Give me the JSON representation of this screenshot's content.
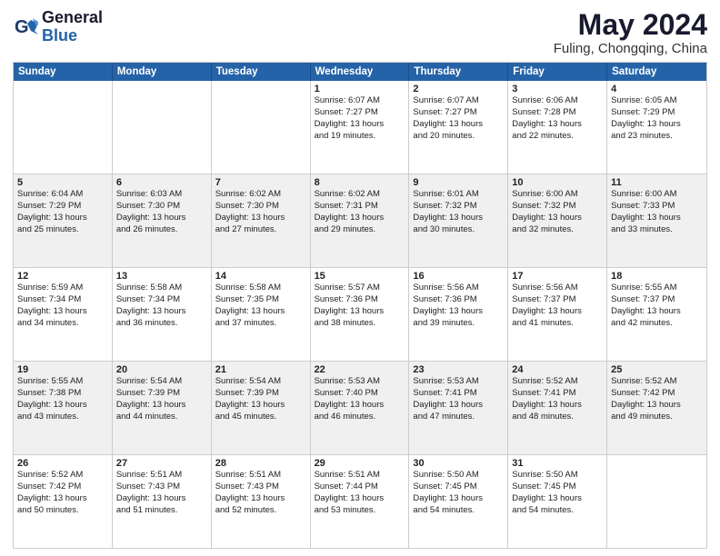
{
  "logo": {
    "line1": "General",
    "line2": "Blue"
  },
  "title": "May 2024",
  "subtitle": "Fuling, Chongqing, China",
  "days": [
    "Sunday",
    "Monday",
    "Tuesday",
    "Wednesday",
    "Thursday",
    "Friday",
    "Saturday"
  ],
  "rows": [
    {
      "alt": false,
      "cells": [
        {
          "day": "",
          "lines": []
        },
        {
          "day": "",
          "lines": []
        },
        {
          "day": "",
          "lines": []
        },
        {
          "day": "1",
          "lines": [
            "Sunrise: 6:07 AM",
            "Sunset: 7:27 PM",
            "Daylight: 13 hours",
            "and 19 minutes."
          ]
        },
        {
          "day": "2",
          "lines": [
            "Sunrise: 6:07 AM",
            "Sunset: 7:27 PM",
            "Daylight: 13 hours",
            "and 20 minutes."
          ]
        },
        {
          "day": "3",
          "lines": [
            "Sunrise: 6:06 AM",
            "Sunset: 7:28 PM",
            "Daylight: 13 hours",
            "and 22 minutes."
          ]
        },
        {
          "day": "4",
          "lines": [
            "Sunrise: 6:05 AM",
            "Sunset: 7:29 PM",
            "Daylight: 13 hours",
            "and 23 minutes."
          ]
        }
      ]
    },
    {
      "alt": true,
      "cells": [
        {
          "day": "5",
          "lines": [
            "Sunrise: 6:04 AM",
            "Sunset: 7:29 PM",
            "Daylight: 13 hours",
            "and 25 minutes."
          ]
        },
        {
          "day": "6",
          "lines": [
            "Sunrise: 6:03 AM",
            "Sunset: 7:30 PM",
            "Daylight: 13 hours",
            "and 26 minutes."
          ]
        },
        {
          "day": "7",
          "lines": [
            "Sunrise: 6:02 AM",
            "Sunset: 7:30 PM",
            "Daylight: 13 hours",
            "and 27 minutes."
          ]
        },
        {
          "day": "8",
          "lines": [
            "Sunrise: 6:02 AM",
            "Sunset: 7:31 PM",
            "Daylight: 13 hours",
            "and 29 minutes."
          ]
        },
        {
          "day": "9",
          "lines": [
            "Sunrise: 6:01 AM",
            "Sunset: 7:32 PM",
            "Daylight: 13 hours",
            "and 30 minutes."
          ]
        },
        {
          "day": "10",
          "lines": [
            "Sunrise: 6:00 AM",
            "Sunset: 7:32 PM",
            "Daylight: 13 hours",
            "and 32 minutes."
          ]
        },
        {
          "day": "11",
          "lines": [
            "Sunrise: 6:00 AM",
            "Sunset: 7:33 PM",
            "Daylight: 13 hours",
            "and 33 minutes."
          ]
        }
      ]
    },
    {
      "alt": false,
      "cells": [
        {
          "day": "12",
          "lines": [
            "Sunrise: 5:59 AM",
            "Sunset: 7:34 PM",
            "Daylight: 13 hours",
            "and 34 minutes."
          ]
        },
        {
          "day": "13",
          "lines": [
            "Sunrise: 5:58 AM",
            "Sunset: 7:34 PM",
            "Daylight: 13 hours",
            "and 36 minutes."
          ]
        },
        {
          "day": "14",
          "lines": [
            "Sunrise: 5:58 AM",
            "Sunset: 7:35 PM",
            "Daylight: 13 hours",
            "and 37 minutes."
          ]
        },
        {
          "day": "15",
          "lines": [
            "Sunrise: 5:57 AM",
            "Sunset: 7:36 PM",
            "Daylight: 13 hours",
            "and 38 minutes."
          ]
        },
        {
          "day": "16",
          "lines": [
            "Sunrise: 5:56 AM",
            "Sunset: 7:36 PM",
            "Daylight: 13 hours",
            "and 39 minutes."
          ]
        },
        {
          "day": "17",
          "lines": [
            "Sunrise: 5:56 AM",
            "Sunset: 7:37 PM",
            "Daylight: 13 hours",
            "and 41 minutes."
          ]
        },
        {
          "day": "18",
          "lines": [
            "Sunrise: 5:55 AM",
            "Sunset: 7:37 PM",
            "Daylight: 13 hours",
            "and 42 minutes."
          ]
        }
      ]
    },
    {
      "alt": true,
      "cells": [
        {
          "day": "19",
          "lines": [
            "Sunrise: 5:55 AM",
            "Sunset: 7:38 PM",
            "Daylight: 13 hours",
            "and 43 minutes."
          ]
        },
        {
          "day": "20",
          "lines": [
            "Sunrise: 5:54 AM",
            "Sunset: 7:39 PM",
            "Daylight: 13 hours",
            "and 44 minutes."
          ]
        },
        {
          "day": "21",
          "lines": [
            "Sunrise: 5:54 AM",
            "Sunset: 7:39 PM",
            "Daylight: 13 hours",
            "and 45 minutes."
          ]
        },
        {
          "day": "22",
          "lines": [
            "Sunrise: 5:53 AM",
            "Sunset: 7:40 PM",
            "Daylight: 13 hours",
            "and 46 minutes."
          ]
        },
        {
          "day": "23",
          "lines": [
            "Sunrise: 5:53 AM",
            "Sunset: 7:41 PM",
            "Daylight: 13 hours",
            "and 47 minutes."
          ]
        },
        {
          "day": "24",
          "lines": [
            "Sunrise: 5:52 AM",
            "Sunset: 7:41 PM",
            "Daylight: 13 hours",
            "and 48 minutes."
          ]
        },
        {
          "day": "25",
          "lines": [
            "Sunrise: 5:52 AM",
            "Sunset: 7:42 PM",
            "Daylight: 13 hours",
            "and 49 minutes."
          ]
        }
      ]
    },
    {
      "alt": false,
      "cells": [
        {
          "day": "26",
          "lines": [
            "Sunrise: 5:52 AM",
            "Sunset: 7:42 PM",
            "Daylight: 13 hours",
            "and 50 minutes."
          ]
        },
        {
          "day": "27",
          "lines": [
            "Sunrise: 5:51 AM",
            "Sunset: 7:43 PM",
            "Daylight: 13 hours",
            "and 51 minutes."
          ]
        },
        {
          "day": "28",
          "lines": [
            "Sunrise: 5:51 AM",
            "Sunset: 7:43 PM",
            "Daylight: 13 hours",
            "and 52 minutes."
          ]
        },
        {
          "day": "29",
          "lines": [
            "Sunrise: 5:51 AM",
            "Sunset: 7:44 PM",
            "Daylight: 13 hours",
            "and 53 minutes."
          ]
        },
        {
          "day": "30",
          "lines": [
            "Sunrise: 5:50 AM",
            "Sunset: 7:45 PM",
            "Daylight: 13 hours",
            "and 54 minutes."
          ]
        },
        {
          "day": "31",
          "lines": [
            "Sunrise: 5:50 AM",
            "Sunset: 7:45 PM",
            "Daylight: 13 hours",
            "and 54 minutes."
          ]
        },
        {
          "day": "",
          "lines": []
        }
      ]
    }
  ]
}
